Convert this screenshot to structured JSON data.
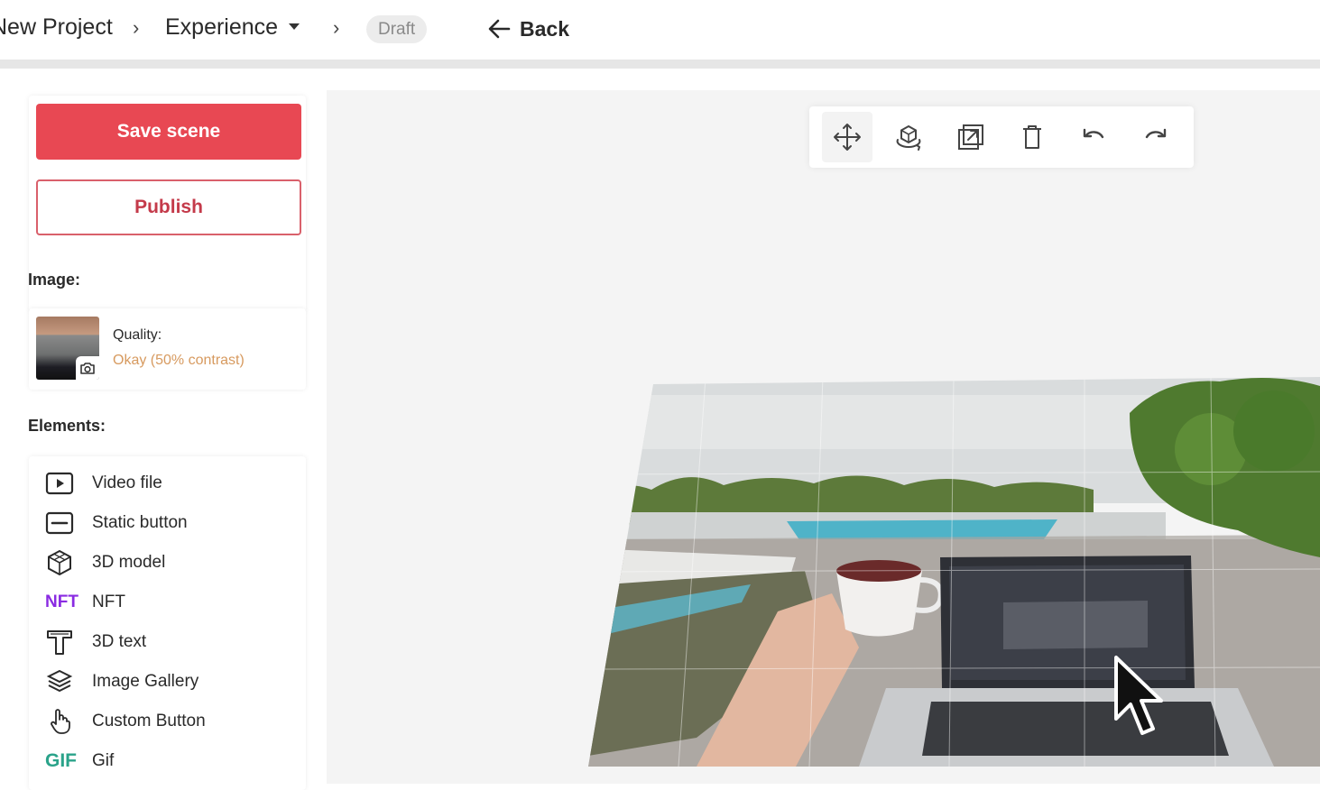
{
  "breadcrumb": {
    "project": "New Project",
    "experience": "Experience",
    "status": "Draft",
    "back_label": "Back"
  },
  "actions": {
    "save_label": "Save scene",
    "publish_label": "Publish"
  },
  "image_section": {
    "heading": "Image:",
    "quality_label": "Quality:",
    "quality_value": "Okay (50% contrast)"
  },
  "elements_section": {
    "heading": "Elements:",
    "items": [
      {
        "label": "Video file",
        "icon": "video-file-icon"
      },
      {
        "label": "Static button",
        "icon": "static-button-icon"
      },
      {
        "label": "3D model",
        "icon": "cube-icon"
      },
      {
        "label": "NFT",
        "icon": "nft-icon",
        "icon_text": "NFT"
      },
      {
        "label": "3D text",
        "icon": "text-3d-icon"
      },
      {
        "label": "Image Gallery",
        "icon": "gallery-icon"
      },
      {
        "label": "Custom Button",
        "icon": "pointer-hand-icon"
      },
      {
        "label": "Gif",
        "icon": "gif-icon",
        "icon_text": "GIF"
      }
    ]
  },
  "toolbar": {
    "tools": [
      "move-icon",
      "rotate-3d-icon",
      "scale-icon",
      "trash-icon",
      "undo-icon",
      "redo-icon"
    ]
  },
  "colors": {
    "primary": "#e84853",
    "quality_warning": "#d79a5f",
    "nft_purple": "#8a2be2",
    "gif_teal": "#2aa38a"
  }
}
